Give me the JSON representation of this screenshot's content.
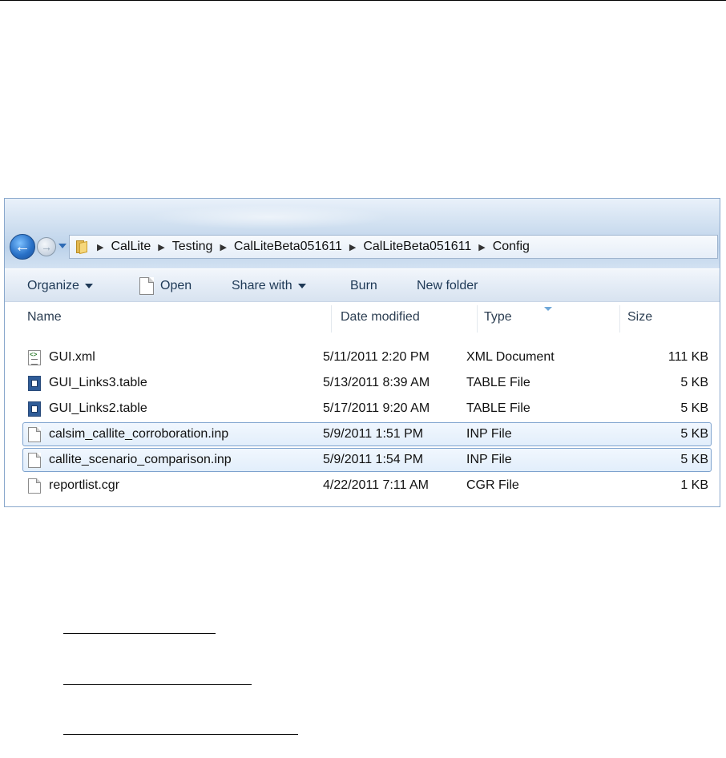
{
  "address_bar": {
    "breadcrumbs": [
      "CalLite",
      "Testing",
      "CalLiteBeta051611",
      "CalLiteBeta051611",
      "Config"
    ]
  },
  "command_bar": {
    "organize_label": "Organize",
    "open_label": "Open",
    "share_with_label": "Share with",
    "burn_label": "Burn",
    "new_folder_label": "New folder"
  },
  "columns": {
    "name": "Name",
    "date_modified": "Date modified",
    "type": "Type",
    "size": "Size"
  },
  "files": [
    {
      "name": "GUI.xml",
      "date": "5/11/2011 2:20 PM",
      "type": "XML Document",
      "size": "111 KB",
      "icon": "xml-file-icon",
      "selected": false
    },
    {
      "name": "GUI_Links3.table",
      "date": "5/13/2011 8:39 AM",
      "type": "TABLE File",
      "size": "5 KB",
      "icon": "table-file-icon",
      "selected": false
    },
    {
      "name": "GUI_Links2.table",
      "date": "5/17/2011 9:20 AM",
      "type": "TABLE File",
      "size": "5 KB",
      "icon": "table-file-icon",
      "selected": false
    },
    {
      "name": "calsim_callite_corroboration.inp",
      "date": "5/9/2011 1:51 PM",
      "type": "INP File",
      "size": "5 KB",
      "icon": "blank-file-icon",
      "selected": true
    },
    {
      "name": "callite_scenario_comparison.inp",
      "date": "5/9/2011 1:54 PM",
      "type": "INP File",
      "size": "5 KB",
      "icon": "blank-file-icon",
      "selected": true
    },
    {
      "name": "reportlist.cgr",
      "date": "4/22/2011 7:11 AM",
      "type": "CGR File",
      "size": "1 KB",
      "icon": "blank-file-icon",
      "selected": false
    }
  ],
  "colors": {
    "selection_border": "#7da2ce",
    "nav_blue": "#2a72c8"
  }
}
